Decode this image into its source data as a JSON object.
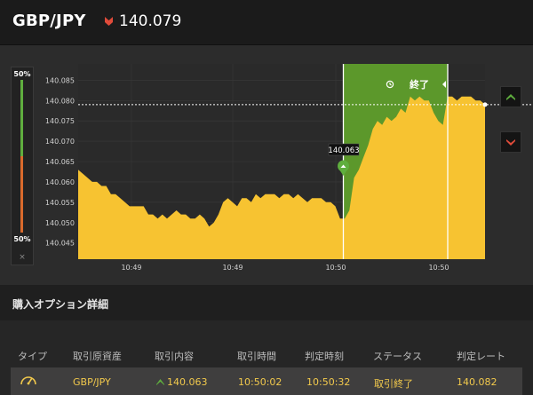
{
  "header": {
    "pair": "GBP/JPY",
    "rate": "140.079",
    "direction_icon": "down-arrow-icon",
    "direction_color": "#e04b3a"
  },
  "ratio": {
    "top_label": "50%",
    "bottom_label": "50%",
    "close": "×",
    "high": 0.5,
    "low": 0.5,
    "high_color": "#5fae3e",
    "low_color": "#d96a2c"
  },
  "chart_overlay": {
    "end_label": "終了",
    "entry_tooltip": "140.063",
    "end_icon": "history-icon",
    "band_color": "#5f9e2b"
  },
  "side_buttons": [
    {
      "icon": "high-arrow-icon",
      "color": "#5fae3e"
    },
    {
      "icon": "low-arrow-icon",
      "color": "#e04b3a"
    }
  ],
  "chart_data": {
    "type": "area",
    "x_tick_labels": [
      "10:49",
      "10:49",
      "10:50",
      "10:50"
    ],
    "y_ticks": [
      140.045,
      140.05,
      140.055,
      140.06,
      140.065,
      140.07,
      140.075,
      140.08,
      140.085
    ],
    "ylim": [
      140.041,
      140.089
    ],
    "current_rate": 140.079,
    "entry_rate": 140.063,
    "series_color": "#f7c331",
    "values": [
      140.063,
      140.062,
      140.061,
      140.06,
      140.06,
      140.059,
      140.059,
      140.057,
      140.057,
      140.056,
      140.055,
      140.054,
      140.054,
      140.054,
      140.054,
      140.052,
      140.052,
      140.051,
      140.052,
      140.051,
      140.052,
      140.053,
      140.052,
      140.052,
      140.051,
      140.051,
      140.052,
      140.051,
      140.049,
      140.05,
      140.052,
      140.055,
      140.056,
      140.055,
      140.054,
      140.056,
      140.056,
      140.055,
      140.057,
      140.056,
      140.057,
      140.057,
      140.057,
      140.056,
      140.057,
      140.057,
      140.056,
      140.057,
      140.056,
      140.055,
      140.056,
      140.056,
      140.056,
      140.055,
      140.055,
      140.054,
      140.051,
      140.051,
      140.053,
      140.061,
      140.063,
      140.066,
      140.069,
      140.073,
      140.075,
      140.074,
      140.076,
      140.075,
      140.076,
      140.078,
      140.077,
      140.081,
      140.08,
      140.081,
      140.08,
      140.08,
      140.077,
      140.075,
      140.074,
      140.081,
      140.081,
      140.08,
      140.081,
      140.081,
      140.081,
      140.08,
      140.08,
      140.079
    ]
  },
  "details": {
    "title": "購入オプション詳細",
    "columns": [
      "タイプ",
      "取引原資産",
      "取引内容",
      "取引時間",
      "判定時刻",
      "ステータス",
      "判定レート"
    ],
    "row": {
      "type_icon": "gauge-icon",
      "asset": "GBP/JPY",
      "content_icon": "high-arrow-icon",
      "content": "140.063",
      "trade_time": "10:50:02",
      "judge_time": "10:50:32",
      "status": "取引終了",
      "judge_rate": "140.082"
    }
  }
}
